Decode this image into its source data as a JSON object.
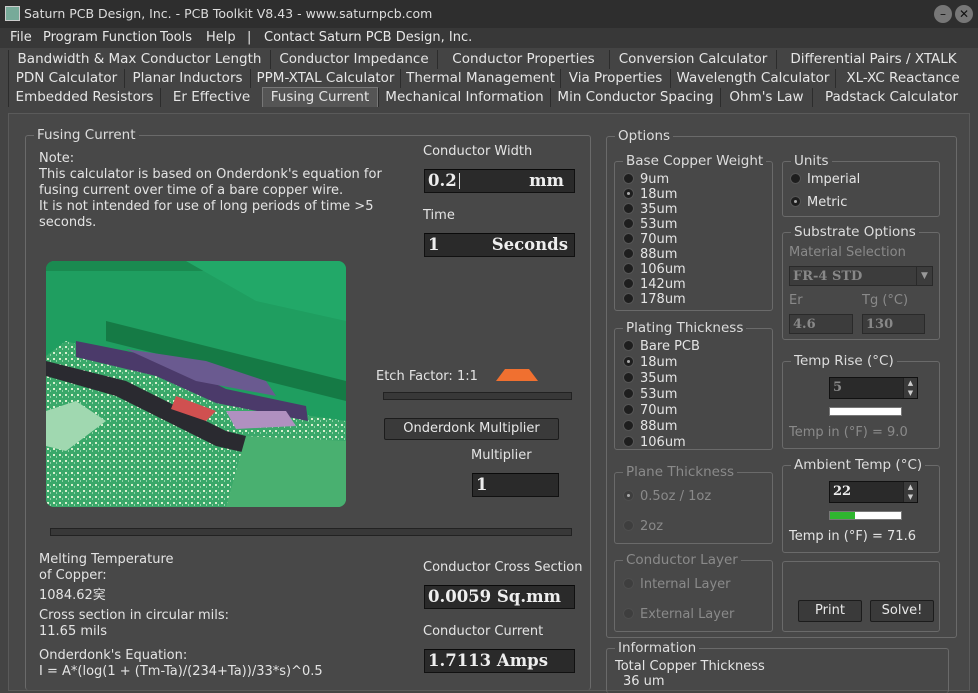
{
  "window": {
    "title": "Saturn PCB Design, Inc. - PCB Toolkit V8.43 - www.saturnpcb.com"
  },
  "menu": [
    "File",
    "Program Function",
    "Tools",
    "Help",
    "|",
    "Contact Saturn PCB Design, Inc."
  ],
  "tabs": {
    "row1": [
      "Bandwidth & Max Conductor Length",
      "Conductor Impedance",
      "Conductor Properties",
      "Conversion Calculator",
      "Differential Pairs / XTALK"
    ],
    "row2": [
      "PDN Calculator",
      "Planar Inductors",
      "PPM-XTAL Calculator",
      "Thermal Management",
      "Via Properties",
      "Wavelength Calculator",
      "XL-XC Reactance"
    ],
    "row3": [
      "Embedded Resistors",
      "Er Effective",
      "Fusing Current",
      "Mechanical Information",
      "Min Conductor Spacing",
      "Ohm's Law",
      "Padstack Calculator"
    ],
    "active": "Fusing Current"
  },
  "fusing": {
    "group_label": "Fusing Current",
    "note_lines": [
      "Note:",
      "This calculator is based on Onderdonk's equation for",
      "fusing current over time of a bare copper wire.",
      "It is not intended for use of long periods of time >5",
      "seconds."
    ],
    "conductor_width_label": "Conductor Width",
    "conductor_width_value": "0.2",
    "conductor_width_unit": "mm",
    "time_label": "Time",
    "time_value": "1",
    "time_unit": "Seconds",
    "etch_factor_label": "Etch Factor:",
    "etch_factor_value": "1:1",
    "onderdonk_button": "Onderdonk Multiplier",
    "multiplier_label": "Multiplier",
    "multiplier_value": "1",
    "melting_label1": "Melting Temperature",
    "melting_label2": "of Copper:",
    "melting_value": "1084.62穾",
    "cross_circ_label": "Cross section in circular mils:",
    "cross_circ_value": "11.65 mils",
    "equation_label": "Onderdonk's Equation:",
    "equation": "I = A*(log(1 + (Tm-Ta)/(234+Ta))/33*s)^0.5",
    "cross_section_label": "Conductor Cross Section",
    "cross_section_value": "0.0059 Sq.mm",
    "current_label": "Conductor Current",
    "current_value": "1.7113 Amps"
  },
  "options": {
    "label": "Options",
    "base_copper": {
      "label": "Base Copper Weight",
      "items": [
        "9um",
        "18um",
        "35um",
        "53um",
        "70um",
        "88um",
        "106um",
        "142um",
        "178um"
      ],
      "selected": "18um"
    },
    "plating": {
      "label": "Plating Thickness",
      "items": [
        "Bare PCB",
        "18um",
        "35um",
        "53um",
        "70um",
        "88um",
        "106um"
      ],
      "selected": "18um"
    },
    "plane": {
      "label": "Plane Thickness",
      "items": [
        "0.5oz / 1oz",
        "2oz"
      ],
      "selected": "0.5oz / 1oz"
    },
    "layer": {
      "label": "Conductor Layer",
      "items": [
        "Internal Layer",
        "External Layer"
      ]
    },
    "units": {
      "label": "Units",
      "items": [
        "Imperial",
        "Metric"
      ],
      "selected": "Metric"
    },
    "substrate": {
      "label": "Substrate Options",
      "material_label": "Material Selection",
      "material_value": "FR-4 STD",
      "er_label": "Er",
      "er_value": "4.6",
      "tg_label": "Tg (°C)",
      "tg_value": "130"
    },
    "temp_rise": {
      "label": "Temp Rise (°C)",
      "value": "5",
      "f_label": "Temp in (°F) = 9.0",
      "level": 0.0
    },
    "ambient": {
      "label": "Ambient Temp (°C)",
      "value": "22",
      "f_label": "Temp in (°F) = 71.6",
      "level": 0.35
    },
    "print_button": "Print",
    "solve_button": "Solve!"
  },
  "information": {
    "label": "Information",
    "total_label": "Total Copper Thickness",
    "total_value": "36 um"
  },
  "colors": {
    "accent_green": "#2fb62f",
    "etch_orange": "#f07030"
  }
}
